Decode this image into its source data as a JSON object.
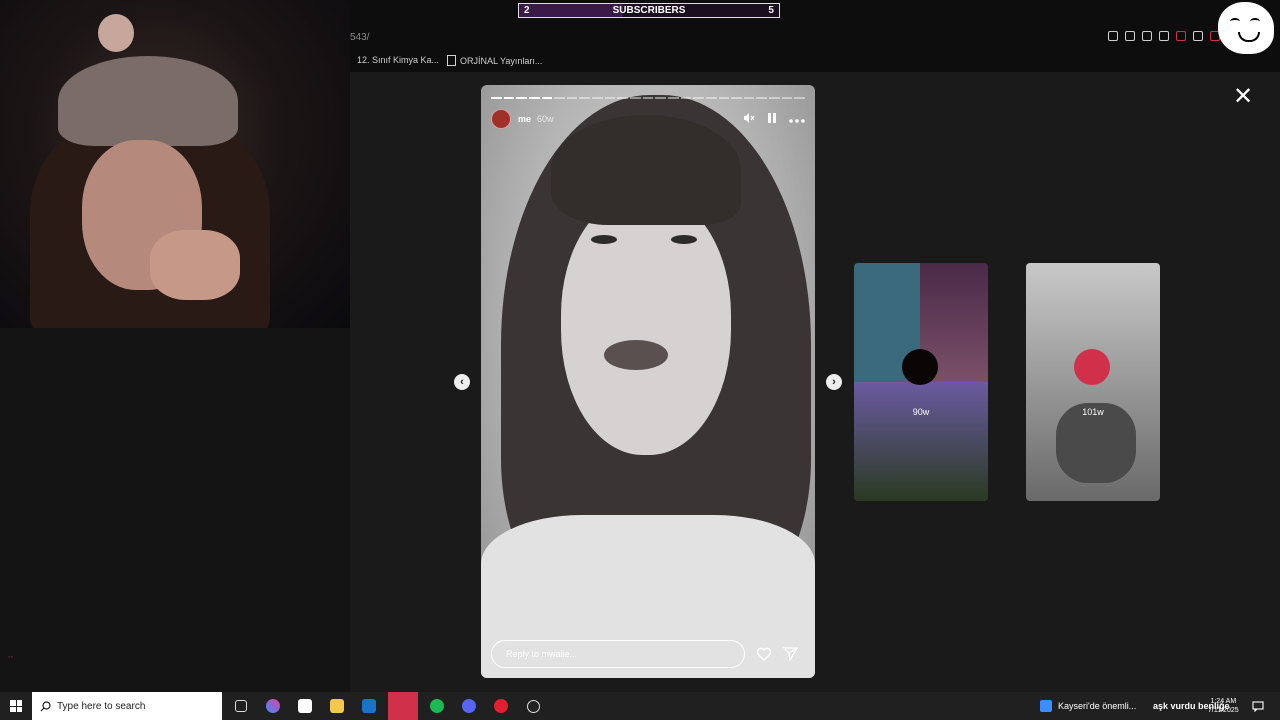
{
  "browser": {
    "url_fragment": "543/",
    "bookmarks": [
      {
        "label": "12. Sınıf Kimya Ka..."
      },
      {
        "label": "ORJİNAL Yayınları..."
      }
    ]
  },
  "overlay": {
    "subscribers": {
      "current": "2",
      "label": "SUBSCRIBERS",
      "goal": "5",
      "progress": 0.4
    }
  },
  "story": {
    "username": "me",
    "age": "60w",
    "reply_placeholder": "Reply to mwaiie...",
    "segments_total": 25,
    "segments_done": 5
  },
  "next_stories": [
    {
      "age": "90w"
    },
    {
      "age": "101w"
    }
  ],
  "taskbar": {
    "search_placeholder": "Type here to search",
    "notification_text": "Kayseri'de önemli...",
    "music_text": "aşk vurdu benliğe",
    "time": "1:24 AM",
    "date": "7/11/2025"
  },
  "colors": {
    "accent_pink": "#d0304a",
    "subscriber_fill": "#3a1a48"
  }
}
